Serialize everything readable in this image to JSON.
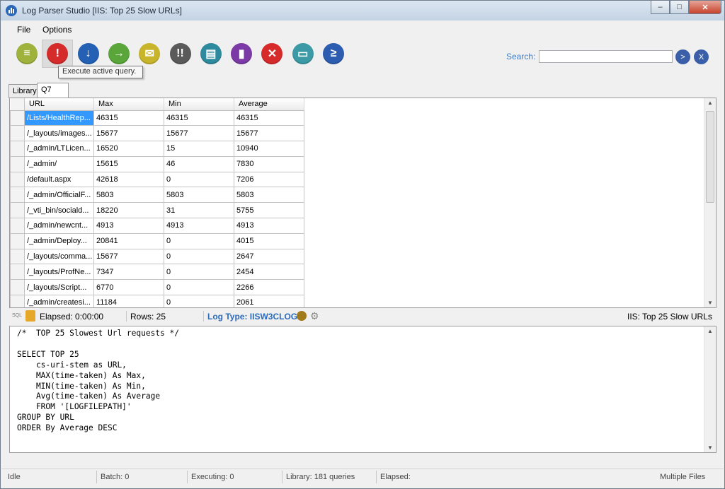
{
  "window": {
    "title": "Log Parser Studio  [IIS: Top 25 Slow URLs]"
  },
  "menu": {
    "file": "File",
    "options": "Options"
  },
  "toolbar": {
    "buttons": [
      {
        "icon": "document-icon",
        "color": "#9fb23c",
        "glyph": "≡"
      },
      {
        "icon": "execute-icon",
        "color": "#d62b2b",
        "glyph": "!"
      },
      {
        "icon": "down-arrow-icon",
        "color": "#2461b5",
        "glyph": "↓"
      },
      {
        "icon": "right-arrow-icon",
        "color": "#5aa63a",
        "glyph": "→"
      },
      {
        "icon": "csv-export-icon",
        "color": "#c9b52c",
        "glyph": "✉"
      },
      {
        "icon": "execute-all-icon",
        "color": "#5a5a5a",
        "glyph": "!!"
      },
      {
        "icon": "log-file-icon",
        "color": "#2e8a9e",
        "glyph": "▤"
      },
      {
        "icon": "chart-icon",
        "color": "#7b3aa6",
        "glyph": "▮"
      },
      {
        "icon": "abort-icon",
        "color": "#d72a2a",
        "glyph": "✕"
      },
      {
        "icon": "output-folder-icon",
        "color": "#3b9aa5",
        "glyph": "▭"
      },
      {
        "icon": "powershell-icon",
        "color": "#2d5db0",
        "glyph": "≥"
      }
    ],
    "tooltip": "Execute active query.",
    "search_label": "Search:",
    "search_value": "",
    "search_go": ">",
    "search_clear": "X"
  },
  "tabs": {
    "library": "Library",
    "query": "Q7"
  },
  "grid": {
    "columns": [
      "URL",
      "Max",
      "Min",
      "Average"
    ],
    "rows": [
      [
        "/Lists/HealthRep...",
        "46315",
        "46315",
        "46315"
      ],
      [
        "/_layouts/images...",
        "15677",
        "15677",
        "15677"
      ],
      [
        "/_admin/LTLicen...",
        "16520",
        "15",
        "10940"
      ],
      [
        "/_admin/",
        "15615",
        "46",
        "7830"
      ],
      [
        "/default.aspx",
        "42618",
        "0",
        "7206"
      ],
      [
        "/_admin/OfficialF...",
        "5803",
        "5803",
        "5803"
      ],
      [
        "/_vti_bin/sociald...",
        "18220",
        "31",
        "5755"
      ],
      [
        "/_admin/newcnt...",
        "4913",
        "4913",
        "4913"
      ],
      [
        "/_admin/Deploy...",
        "20841",
        "0",
        "4015"
      ],
      [
        "/_layouts/comma...",
        "15677",
        "0",
        "2647"
      ],
      [
        "/_layouts/ProfNe...",
        "7347",
        "0",
        "2454"
      ],
      [
        "/_layouts/Script...",
        "6770",
        "0",
        "2266"
      ],
      [
        "/_admin/createsi...",
        "11184",
        "0",
        "2061"
      ]
    ]
  },
  "query_status": {
    "sql_badge": "SQL",
    "elapsed": "Elapsed: 0:00:00",
    "rows": "Rows: 25",
    "log_type": "Log Type: IISW3CLOG",
    "query_name": "IIS: Top 25 Slow URLs"
  },
  "editor": {
    "sql": "/*  TOP 25 Slowest Url requests */\n\nSELECT TOP 25\n    cs-uri-stem as URL,\n    MAX(time-taken) As Max,\n    MIN(time-taken) As Min,\n    Avg(time-taken) As Average\n    FROM '[LOGFILEPATH]'\nGROUP BY URL\nORDER By Average DESC"
  },
  "statusbar": {
    "state": "Idle",
    "batch": "Batch: 0",
    "executing": "Executing: 0",
    "library": "Library: 181 queries",
    "elapsed": "Elapsed:",
    "files": "Multiple Files"
  }
}
